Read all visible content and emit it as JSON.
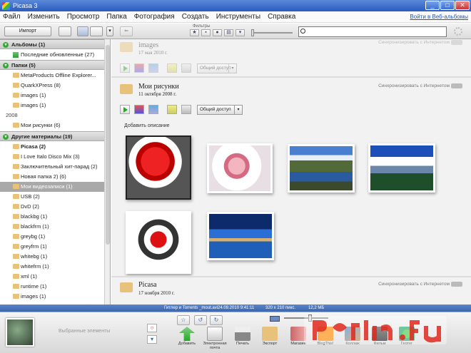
{
  "window": {
    "title": "Picasa 3",
    "min": "_",
    "max": "□",
    "close": "✕"
  },
  "menu": [
    "Файл",
    "Изменить",
    "Просмотр",
    "Папка",
    "Фотография",
    "Создать",
    "Инструменты",
    "Справка"
  ],
  "signin": "Войти в Веб-альбомы",
  "toolbar": {
    "import_label": "Импорт",
    "filters_label": "Фильтры",
    "search_value": ""
  },
  "sidebar": {
    "albums_header": "Альбомы (1)",
    "album_items": [
      "Последние обновленные (27)"
    ],
    "folders_header": "Папки (5)",
    "folder_items": [
      "MetaProducts Offline Explorer...",
      "QuarkXPress (8)",
      "images (1)",
      "images (1)"
    ],
    "year_2008": "2008",
    "year_items": [
      "Мои рисунки (6)"
    ],
    "other_header": "Другие материалы (19)",
    "other_items": [
      "Picasa (2)",
      "I Love Italo Disco Mix (3)",
      "Заключительный хит-парад (2)",
      "Новая папка 2) (6)",
      "Мои видеозаписи (1)",
      "USB (2)",
      "DvD (2)",
      "blackbg (1)",
      "blackfrm (1)",
      "greybg (1)",
      "greyfrm (1)",
      "whitebg (1)",
      "whitefrm (1)",
      "xml (1)",
      "runtime (1)",
      "images (1)"
    ]
  },
  "groups": [
    {
      "name": "images",
      "date": "17 мая 2010 г.",
      "sync": "Синхронизировать с Интернетом",
      "share": "Общий доступ"
    },
    {
      "name": "Мои рисунки",
      "date": "11 октября 2008 г.",
      "sync": "Синхронизировать с Интернетом",
      "share": "Общий доступ",
      "add_caption": "Добавить описание"
    },
    {
      "name": "Picasa",
      "date": "17 ноября 2010 г.",
      "sync": "Синхронизировать с Интернетом"
    }
  ],
  "status": {
    "file": "Гитлер и Torrents _mout.avi",
    "datetime": "24.09.2010 9:41:11",
    "dims": "320 x 210 пикс.",
    "size": "12,2 МБ"
  },
  "bottom": {
    "tray_label": "Выбранные элементы",
    "actions": [
      "Добавить",
      "Электронная почта",
      "Печать",
      "Экспорт",
      "Магазин",
      "BlogThis!",
      "Коллаж",
      "Фильм",
      "Геотег"
    ]
  },
  "colors": {
    "accent": "#2a5cc0",
    "selection": "#a9a9a9",
    "status": "#4a76bb"
  }
}
